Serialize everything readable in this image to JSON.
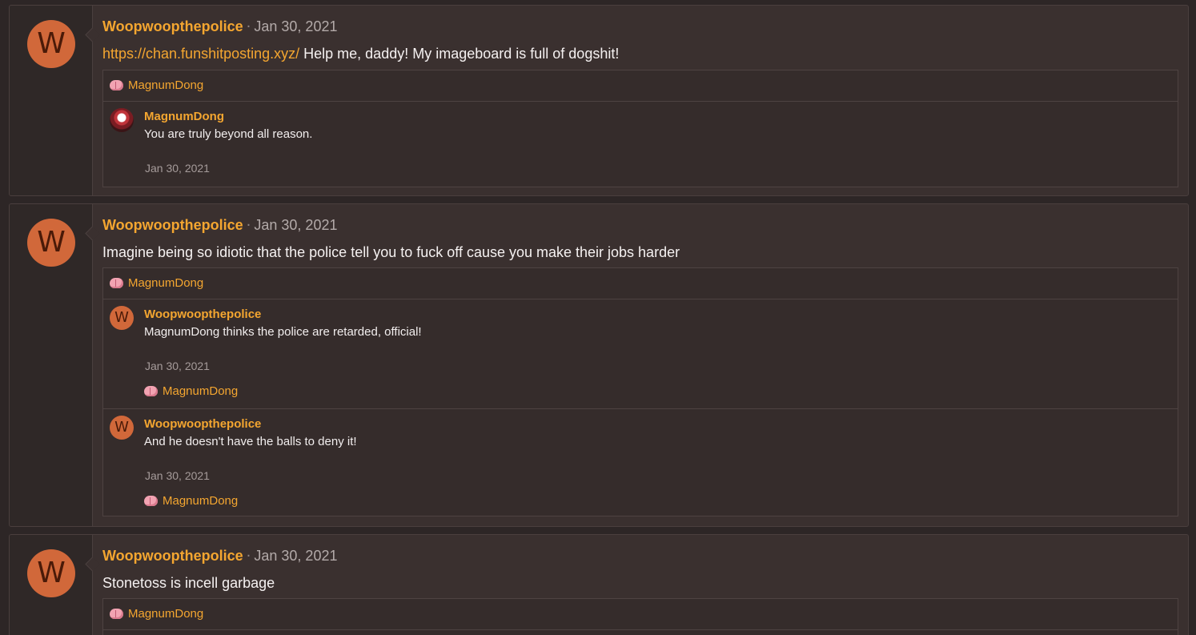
{
  "posts": [
    {
      "avatar_letter": "W",
      "author": "Woopwoopthepolice",
      "separator": "·",
      "date": "Jan 30, 2021",
      "link": "https://chan.funshitposting.xyz/",
      "text": " Help me, daddy! My imageboard is full of dogshit!",
      "reaction_user": "MagnumDong",
      "replies": [
        {
          "author": "MagnumDong",
          "text": "You are truly beyond all reason.",
          "date": "Jan 30, 2021"
        }
      ]
    },
    {
      "avatar_letter": "W",
      "author": "Woopwoopthepolice",
      "separator": "·",
      "date": "Jan 30, 2021",
      "text": "Imagine being so idiotic that the police tell you to fuck off cause you make their jobs harder",
      "reaction_user": "MagnumDong",
      "replies": [
        {
          "avatar_letter": "W",
          "author": "Woopwoopthepolice",
          "text": "MagnumDong thinks the police are retarded, official!",
          "date": "Jan 30, 2021",
          "reaction_user": "MagnumDong"
        },
        {
          "avatar_letter": "W",
          "author": "Woopwoopthepolice",
          "text": "And he doesn't have the balls to deny it!",
          "date": "Jan 30, 2021",
          "reaction_user": "MagnumDong"
        }
      ]
    },
    {
      "avatar_letter": "W",
      "author": "Woopwoopthepolice",
      "separator": "·",
      "date": "Jan 30, 2021",
      "text": "Stonetoss is incell garbage",
      "reaction_user": "MagnumDong"
    }
  ],
  "colors": {
    "accent": "#f4a630",
    "avatar": "#d1683a",
    "background": "#2d2626",
    "panel": "#3a302f"
  },
  "icons": {
    "reaction": "brain-icon"
  }
}
